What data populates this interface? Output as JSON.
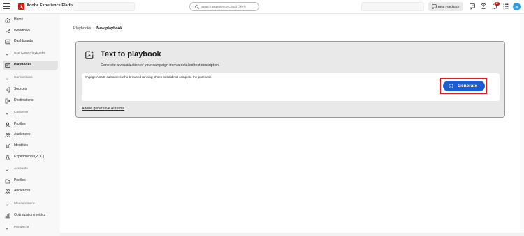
{
  "header": {
    "app_title": "Adobe Experience Platform",
    "search_placeholder": "Search Experience Cloud (⌘+/)",
    "beta_feedback_label": "Beta Feedback",
    "notification_count": "9+",
    "brand_color": "#eb1000"
  },
  "sidebar": {
    "home": "Home",
    "workflows": "Workflows",
    "dashboards": "Dashboards",
    "use_case_playbooks_section": "Use Case Playbooks",
    "playbooks": "Playbooks",
    "connections_section": "Connections",
    "sources": "Sources",
    "destinations": "Destinations",
    "customer_section": "Customer",
    "customer_profiles": "Profiles",
    "customer_audiences": "Audiences",
    "identities": "Identities",
    "experiments": "Experiments (POC)",
    "accounts_section": "Accounts",
    "account_profiles": "Profiles",
    "account_audiences": "Audiences",
    "measurement_section": "Measurement",
    "optimization_metrics": "Optimization metrics",
    "prospects_section": "Prospects"
  },
  "breadcrumb": {
    "parent": "Playbooks",
    "separator": "›",
    "current": "New playbook"
  },
  "panel": {
    "title": "Text to playbook",
    "subtitle": "Generate a visualization of your campaign from a detailed text description.",
    "prompt_text": "Engage ACME customers who browsed running shoes but did not complete the purchase.",
    "generate_label": "Generate",
    "terms_link": "Adobe generative AI terms",
    "accent_color": "#1a5bd6",
    "highlight_color": "#e01e1e"
  }
}
